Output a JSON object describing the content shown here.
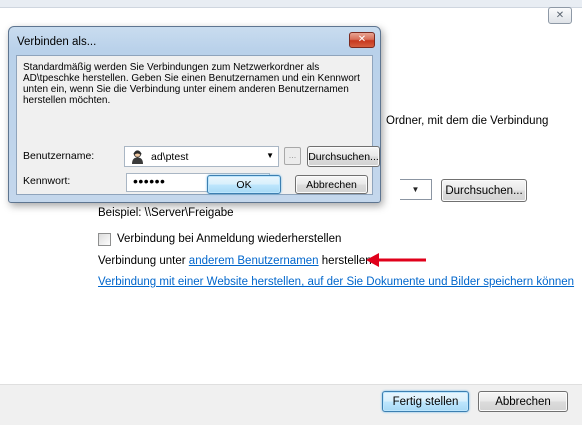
{
  "wizard": {
    "close_glyph": "✕",
    "partial_text": "Ordner, mit dem die Verbindung",
    "browse_label": "Durchsuchen...",
    "example_text": "Beispiel: \\\\Server\\Freigabe",
    "reconnect_label": "Verbindung bei Anmeldung wiederherstellen",
    "connect_prefix": "Verbindung unter ",
    "connect_link": "anderem Benutzernamen",
    "connect_suffix": " herstellen",
    "website_link": "Verbindung mit einer Website herstellen, auf der Sie Dokumente und Bilder speichern können",
    "finish_label": "Fertig stellen",
    "cancel_label": "Abbrechen"
  },
  "dialog": {
    "title": "Verbinden als...",
    "close_glyph": "✕",
    "description": "Standardmäßig werden Sie Verbindungen zum Netzwerkordner als AD\\tpeschke herstellen. Geben Sie einen Benutzernamen und ein Kennwort unten ein, wenn Sie die Verbindung unter einem anderen Benutzernamen herstellen möchten.",
    "username_label": "Benutzername:",
    "username_value": "ad\\ptest",
    "ellipsis_label": "...",
    "browse_label": "Durchsuchen...",
    "password_label": "Kennwort:",
    "password_value": "••••••",
    "ok_label": "OK",
    "cancel_label": "Abbrechen"
  },
  "colors": {
    "link": "#0066cc",
    "arrow": "#e0001b",
    "dialog_frame": "#b9d1ea"
  },
  "icons": {
    "user": "user-account-icon",
    "dropdown": "chevron-down-icon",
    "annotation": "red-arrow-icon"
  }
}
